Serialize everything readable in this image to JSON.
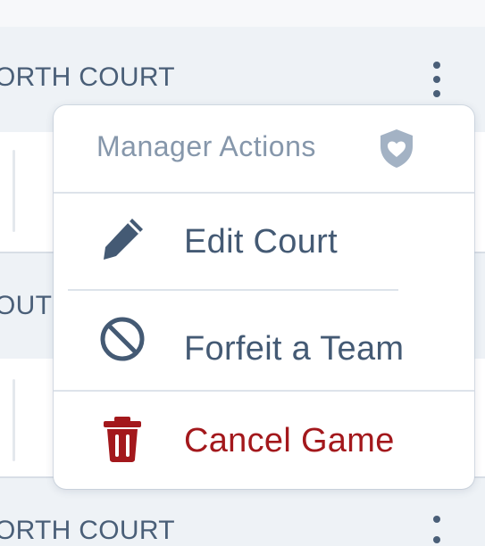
{
  "colors": {
    "text_primary": "#445a74",
    "text_muted": "#8697ab",
    "danger": "#a3181c",
    "background": "#eef2f6"
  },
  "courts": [
    {
      "label": "ORTH COURT"
    },
    {
      "label": "OUT"
    },
    {
      "label": "ORTH COURT"
    }
  ],
  "row_menu_icon": "kebab-icon",
  "menu": {
    "title": "Manager Actions",
    "title_icon": "shield-heart-icon",
    "items": [
      {
        "label": "Edit Court",
        "icon": "pencil-icon"
      },
      {
        "label": "Forfeit a Team",
        "icon": "ban-icon"
      },
      {
        "label": "Cancel Game",
        "icon": "trash-icon"
      }
    ]
  }
}
